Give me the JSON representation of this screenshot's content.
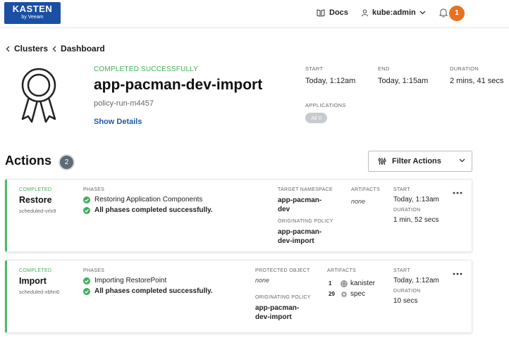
{
  "topbar": {
    "logo_line1": "KASTEN",
    "logo_line2": "by Veeam",
    "docs_label": "Docs",
    "user_label": "kube:admin",
    "notification_count": "1"
  },
  "breadcrumb": {
    "items": [
      "Clusters",
      "Dashboard"
    ]
  },
  "run": {
    "status": "COMPLETED SUCCESSFULLY",
    "title": "app-pacman-dev-import",
    "policy_run": "policy-run-m4457",
    "show_details": "Show Details",
    "start_label": "START",
    "start_value": "Today, 1:12am",
    "end_label": "END",
    "end_value": "Today, 1:15am",
    "duration_label": "DURATION",
    "duration_value": "2 mins, 41 secs",
    "applications_label": "APPLICATIONS",
    "applications_pill": "All 0"
  },
  "actions": {
    "title": "Actions",
    "count": "2",
    "filter_label": "Filter Actions",
    "cards": [
      {
        "status": "COMPLETED",
        "type": "Restore",
        "id": "scheduled-vrlx9",
        "phases_label": "PHASES",
        "phase1": "Restoring Application Components",
        "phase2": "All phases completed successfully.",
        "col3_label": "TARGET NAMESPACE",
        "col3_value_line1": "app-pacman-",
        "col3_value_line2": "dev",
        "col3b_label": "ORIGINATING POLICY",
        "col3b_value_line1": "app-pacman-",
        "col3b_value_line2": "dev-import",
        "artifacts_label": "ARTIFACTS",
        "artifacts_value": "none",
        "start_label": "START",
        "start_value": "Today, 1:13am",
        "duration_label": "DURATION",
        "duration_value": "1 min, 52 secs"
      },
      {
        "status": "COMPLETED",
        "type": "Import",
        "id": "scheduled-xbhn6",
        "phases_label": "PHASES",
        "phase1": "Importing RestorePoint",
        "phase2": "All phases completed successfully.",
        "col3_label": "PROTECTED OBJECT",
        "col3_value": "none",
        "col3b_label": "ORIGINATING POLICY",
        "col3b_value_line1": "app-pacman-",
        "col3b_value_line2": "dev-import",
        "artifacts_label": "ARTIFACTS",
        "artifact1_count": "1",
        "artifact1_name": "kanister",
        "artifact2_count": "29",
        "artifact2_name": "spec",
        "start_label": "START",
        "start_value": "Today, 1:12am",
        "duration_label": "DURATION",
        "duration_value": "10 secs"
      }
    ]
  },
  "colors": {
    "brand_blue": "#1a4fa3",
    "success_green": "#3fae5a",
    "notification_orange": "#e8711f",
    "link_blue": "#1f5aa8"
  },
  "icons": [
    "book-icon",
    "user-icon",
    "chevron-down-icon",
    "bell-icon",
    "chevron-left-icon",
    "award-ribbon-icon",
    "filter-icon",
    "check-circle-icon",
    "kebab-menu-icon",
    "kanister-icon",
    "spec-gear-icon"
  ]
}
